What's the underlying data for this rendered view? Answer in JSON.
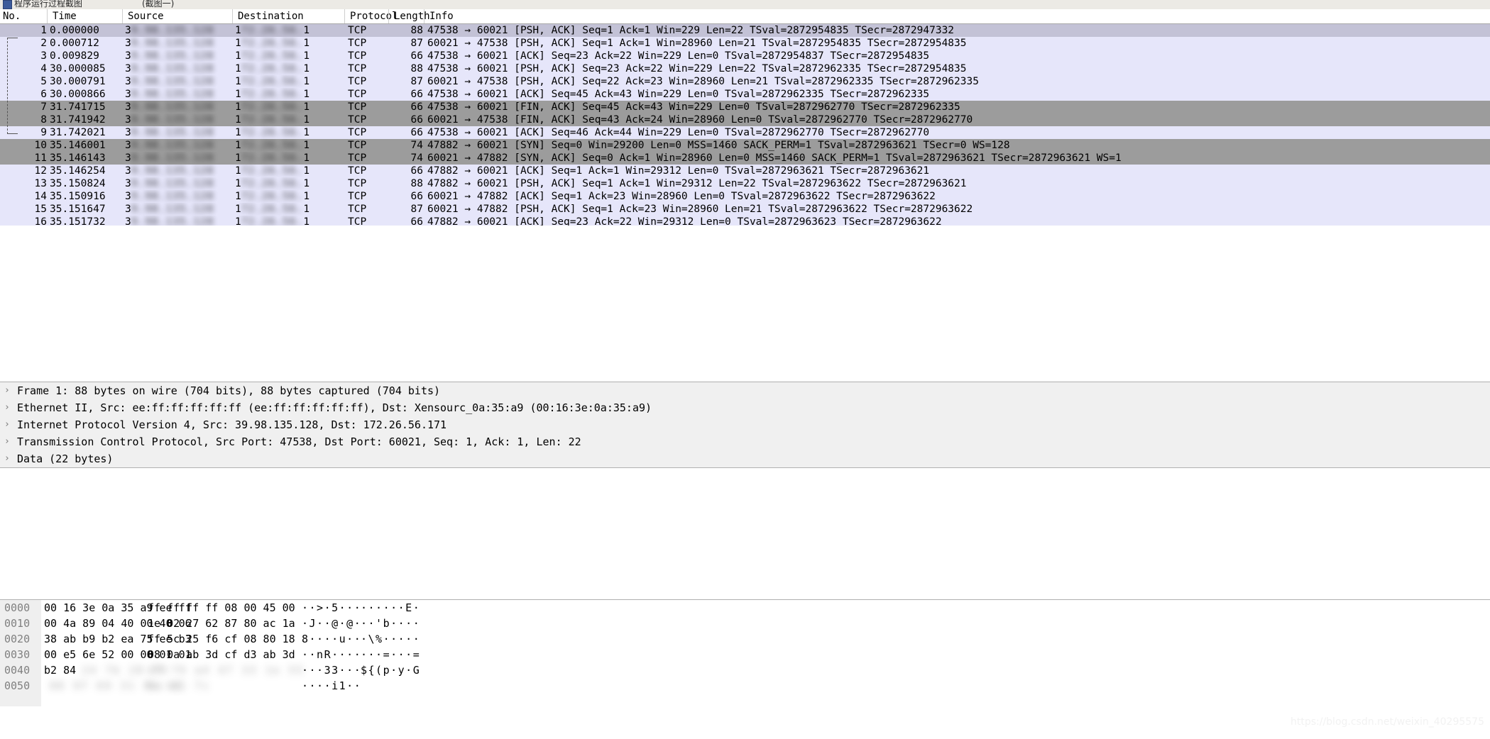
{
  "window": {
    "title": "程序运行过程截图",
    "subtitle": "(截图一)",
    "icon": "wireshark-icon"
  },
  "packet_list": {
    "columns": [
      {
        "key": "no",
        "label": "No."
      },
      {
        "key": "time",
        "label": "Time"
      },
      {
        "key": "source",
        "label": "Source"
      },
      {
        "key": "destination",
        "label": "Destination"
      },
      {
        "key": "protocol",
        "label": "Protocol"
      },
      {
        "key": "length",
        "label": "Length"
      },
      {
        "key": "info",
        "label": "Info"
      }
    ],
    "source_prefix": "3",
    "destination_prefix": "1",
    "destination_suffix": "1",
    "rows": [
      {
        "no": "1",
        "time": "0.000000",
        "protocol": "TCP",
        "length": "88",
        "info": "47538 → 60021 [PSH, ACK] Seq=1 Ack=1 Win=229 Len=22 TSval=2872954835 TSecr=2872947332",
        "state": "sel"
      },
      {
        "no": "2",
        "time": "0.000712",
        "protocol": "TCP",
        "length": "87",
        "info": "60021 → 47538 [PSH, ACK] Seq=1 Ack=1 Win=28960 Len=21 TSval=2872954835 TSecr=2872954835",
        "state": "even"
      },
      {
        "no": "3",
        "time": "0.009829",
        "protocol": "TCP",
        "length": "66",
        "info": "47538 → 60021 [ACK] Seq=23 Ack=22 Win=229 Len=0 TSval=2872954837 TSecr=2872954835",
        "state": "even"
      },
      {
        "no": "4",
        "time": "30.000085",
        "protocol": "TCP",
        "length": "88",
        "info": "47538 → 60021 [PSH, ACK] Seq=23 Ack=22 Win=229 Len=22 TSval=2872962335 TSecr=2872954835",
        "state": "even"
      },
      {
        "no": "5",
        "time": "30.000791",
        "protocol": "TCP",
        "length": "87",
        "info": "60021 → 47538 [PSH, ACK] Seq=22 Ack=23 Win=28960 Len=21 TSval=2872962335 TSecr=2872962335",
        "state": "even"
      },
      {
        "no": "6",
        "time": "30.000866",
        "protocol": "TCP",
        "length": "66",
        "info": "47538 → 60021 [ACK] Seq=45 Ack=43 Win=229 Len=0 TSval=2872962335 TSecr=2872962335",
        "state": "even"
      },
      {
        "no": "7",
        "time": "31.741715",
        "protocol": "TCP",
        "length": "66",
        "info": "47538 → 60021 [FIN, ACK] Seq=45 Ack=43 Win=229 Len=0 TSval=2872962770 TSecr=2872962335",
        "state": "gray"
      },
      {
        "no": "8",
        "time": "31.741942",
        "protocol": "TCP",
        "length": "66",
        "info": "60021 → 47538 [FIN, ACK] Seq=43 Ack=24 Win=28960 Len=0 TSval=2872962770 TSecr=2872962770",
        "state": "gray"
      },
      {
        "no": "9",
        "time": "31.742021",
        "protocol": "TCP",
        "length": "66",
        "info": "47538 → 60021 [ACK] Seq=46 Ack=44 Win=229 Len=0 TSval=2872962770 TSecr=2872962770",
        "state": "even"
      },
      {
        "no": "10",
        "time": "35.146001",
        "protocol": "TCP",
        "length": "74",
        "info": "47882 → 60021 [SYN] Seq=0 Win=29200 Len=0 MSS=1460 SACK_PERM=1 TSval=2872963621 TSecr=0 WS=128",
        "state": "gray"
      },
      {
        "no": "11",
        "time": "35.146143",
        "protocol": "TCP",
        "length": "74",
        "info": "60021 → 47882 [SYN, ACK] Seq=0 Ack=1 Win=28960 Len=0 MSS=1460 SACK_PERM=1 TSval=2872963621 TSecr=2872963621 WS=1",
        "state": "gray"
      },
      {
        "no": "12",
        "time": "35.146254",
        "protocol": "TCP",
        "length": "66",
        "info": "47882 → 60021 [ACK] Seq=1 Ack=1 Win=29312 Len=0 TSval=2872963621 TSecr=2872963621",
        "state": "even"
      },
      {
        "no": "13",
        "time": "35.150824",
        "protocol": "TCP",
        "length": "88",
        "info": "47882 → 60021 [PSH, ACK] Seq=1 Ack=1 Win=29312 Len=22 TSval=2872963622 TSecr=2872963621",
        "state": "even"
      },
      {
        "no": "14",
        "time": "35.150916",
        "protocol": "TCP",
        "length": "66",
        "info": "60021 → 47882 [ACK] Seq=1 Ack=23 Win=28960 Len=0 TSval=2872963622 TSecr=2872963622",
        "state": "even"
      },
      {
        "no": "15",
        "time": "35.151647",
        "protocol": "TCP",
        "length": "87",
        "info": "60021 → 47882 [PSH, ACK] Seq=1 Ack=23 Win=28960 Len=21 TSval=2872963622 TSecr=2872963622",
        "state": "even"
      },
      {
        "no": "16",
        "time": "35.151732",
        "protocol": "TCP",
        "length": "66",
        "info": "47882 → 60021 [ACK] Seq=23 Ack=22 Win=29312 Len=0 TSval=2872963623 TSecr=2872963622",
        "state": "even"
      }
    ]
  },
  "detail_pane": {
    "twisty": "›",
    "rows": [
      {
        "text": "Frame 1: 88 bytes on wire (704 bits), 88 bytes captured (704 bits)"
      },
      {
        "text": "Ethernet II, Src: ee:ff:ff:ff:ff:ff (ee:ff:ff:ff:ff:ff), Dst: Xensourc_0a:35:a9 (00:16:3e:0a:35:a9)"
      },
      {
        "text": "Internet Protocol Version 4, Src: 39.98.135.128, Dst: 172.26.56.171"
      },
      {
        "text": "Transmission Control Protocol, Src Port: 47538, Dst Port: 60021, Seq: 1, Ack: 1, Len: 22"
      },
      {
        "text": "Data (22 bytes)"
      }
    ]
  },
  "hex_pane": {
    "rows": [
      {
        "offset": "0000",
        "hex1": "00 16 3e 0a 35 a9 ee ff",
        "hex2": "ff ff ff ff 08 00 45 00",
        "ascii1": "··>·5···",
        "ascii2": "······E·",
        "blurred": false
      },
      {
        "offset": "0010",
        "hex1": "00 4a 89 04 40 00 40 06",
        "hex2": "1e 02 27 62 87 80 ac 1a",
        "ascii1": "·J··@·@·",
        "ascii2": "··'b····",
        "blurred": false
      },
      {
        "offset": "0020",
        "hex1": "38 ab b9 b2 ea 75 ee b3",
        "hex2": "ff 5c 25 f6 cf 08 80 18",
        "ascii1": "8····u··",
        "ascii2": "·\\%·····",
        "blurred": false
      },
      {
        "offset": "0030",
        "hex1": "00 e5 6e 52 00 00 01 01",
        "hex2": "08 0a ab 3d cf d3 ab 3d",
        "ascii1": "··nR····",
        "ascii2": "···=···=",
        "blurred": false
      },
      {
        "offset": "0040",
        "hex1": "b2 84",
        "hex2": "",
        "ascii1": "···33···",
        "ascii2": "${(p·y·G",
        "blurred": true
      },
      {
        "offset": "0050",
        "hex1": "",
        "hex2": "",
        "ascii1": "····i1··",
        "ascii2": "",
        "blurred": true
      }
    ]
  },
  "watermark": {
    "text": "https://blog.csdn.net/weixin_40295575"
  },
  "colors": {
    "row_even": "#e6e6fa",
    "row_selected": "#c3c2d6",
    "row_gray": "#9c9c9c",
    "detail_bg": "#f0f0f0",
    "hex_gutter": "#efefef"
  }
}
